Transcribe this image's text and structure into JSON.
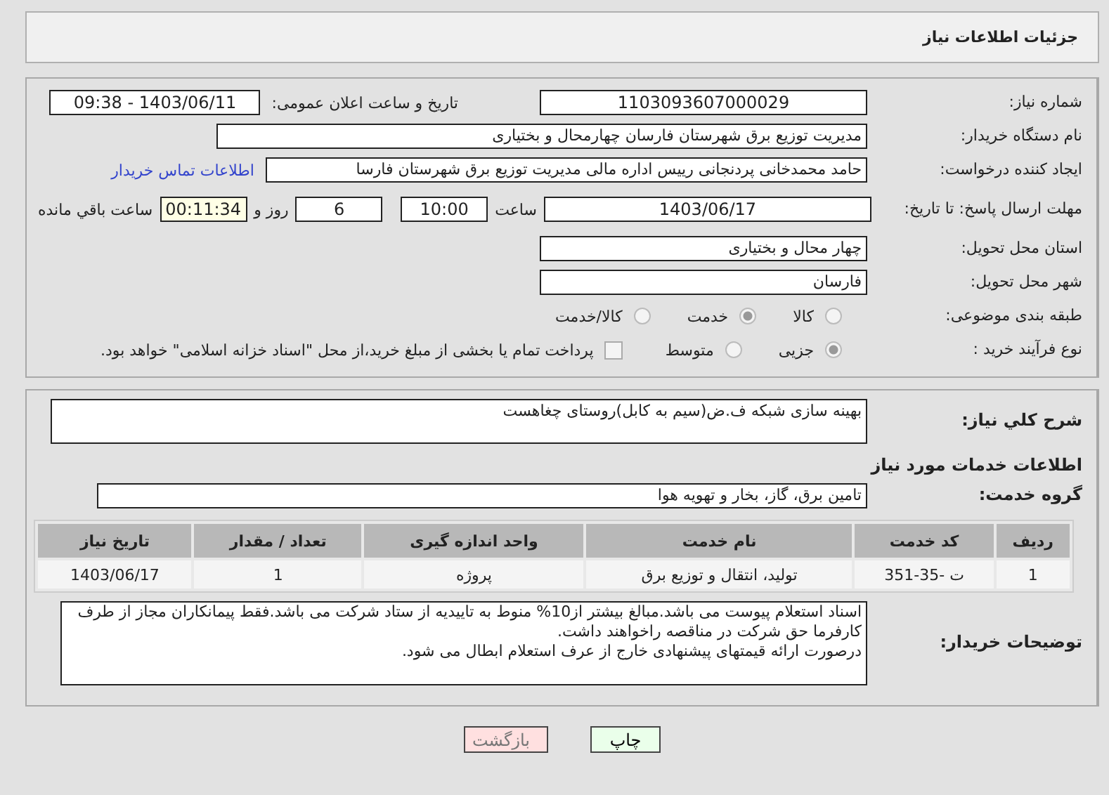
{
  "header": {
    "title": "جزئیات اطلاعات نیاز"
  },
  "need_number": {
    "label": "شماره نیاز:",
    "value": "1103093607000029"
  },
  "announce": {
    "label": "تاریخ و ساعت اعلان عمومی:",
    "value": "1403/06/11 - 09:38"
  },
  "buyer": {
    "label": "نام دستگاه خریدار:",
    "value": "مدیریت توزیع برق شهرستان فارسان چهارمحال و بختیاری"
  },
  "creator": {
    "label": "ایجاد کننده درخواست:",
    "value": "حامد محمدخانی پردنجانی رییس اداره مالی مدیریت توزیع برق شهرستان فارسا",
    "link": "اطلاعات تماس خریدار"
  },
  "deadline": {
    "label": "مهلت ارسال پاسخ: تا تاریخ:",
    "date": "1403/06/17",
    "time_label": "ساعت",
    "time": "10:00",
    "days": "6",
    "days_label": "روز و",
    "remaining": "00:11:34",
    "remaining_label": "ساعت باقي مانده"
  },
  "province": {
    "label": "استان محل تحویل:",
    "value": "چهار محال و بختیاری"
  },
  "city": {
    "label": "شهر محل تحویل:",
    "value": "فارسان"
  },
  "category": {
    "label": "طبقه بندی موضوعی:",
    "options": [
      {
        "label": "کالا",
        "selected": false
      },
      {
        "label": "خدمت",
        "selected": true
      },
      {
        "label": "کالا/خدمت",
        "selected": false
      }
    ]
  },
  "process": {
    "label": "نوع فرآیند خرید :",
    "options": [
      {
        "label": "جزیی",
        "selected": true
      },
      {
        "label": "متوسط",
        "selected": false
      }
    ],
    "payment": {
      "label": "پرداخت تمام یا بخشی از مبلغ خرید،از محل \"اسناد خزانه اسلامی\" خواهد بود.",
      "checked": false
    }
  },
  "description": {
    "label": "شرح کلي نياز:",
    "value": "بهینه سازی شبکه ف.ض(سیم به کابل)روستای چغاهست"
  },
  "services_title": "اطلاعات خدمات مورد نياز",
  "service_group": {
    "label": "گروه خدمت:",
    "value": "تامین برق، گاز، بخار و تهویه هوا"
  },
  "table": {
    "columns": [
      "ردیف",
      "کد خدمت",
      "نام خدمت",
      "واحد اندازه گیری",
      "تعداد / مقدار",
      "تاریخ نیاز"
    ],
    "rows": [
      [
        "1",
        "ت -35-351",
        "تولید، انتقال و توزیع برق",
        "پروژه",
        "1",
        "1403/06/17"
      ]
    ]
  },
  "notes": {
    "label": "توضیحات خریدار:",
    "lines": [
      "اسناد استعلام پیوست می باشد.مبالغ بیشتر از10% منوط به تاییدیه از ستاد شرکت می باشد.فقط پیمانکاران مجاز از طرف کارفرما حق شرکت در مناقصه راخواهند داشت.",
      "درصورت ارائه قیمتهای پیشنهادی خارج از عرف استعلام ابطال می شود."
    ]
  },
  "buttons": [
    {
      "label": "چاپ",
      "kind": "print"
    },
    {
      "label": "بازگشت",
      "kind": "back"
    }
  ]
}
